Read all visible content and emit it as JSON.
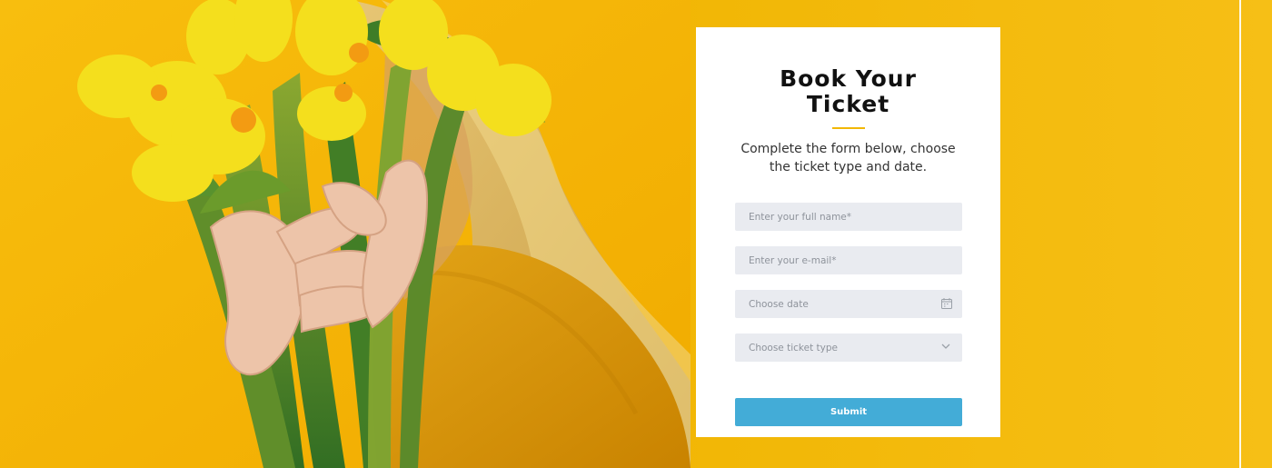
{
  "form": {
    "title": "Book Your Ticket",
    "description": "Complete the form below, choose the ticket type and date.",
    "fields": {
      "full_name": {
        "placeholder": "Enter your full name*",
        "value": ""
      },
      "email": {
        "placeholder": "Enter your e-mail*",
        "value": ""
      },
      "date": {
        "placeholder": "Choose date",
        "icon": "calendar-icon"
      },
      "ticket_type": {
        "selected": "Choose ticket type",
        "icon": "chevron-down-icon"
      }
    },
    "submit_label": "Submit"
  },
  "colors": {
    "background": "#f3b300",
    "card": "#ffffff",
    "accent": "#f2b705",
    "button": "#43acd7",
    "input_bg": "#e9ebf0"
  }
}
